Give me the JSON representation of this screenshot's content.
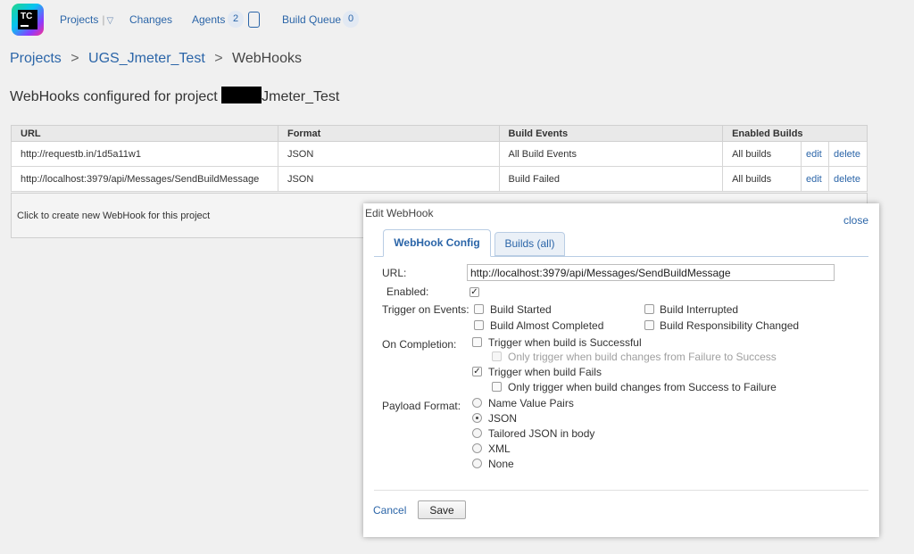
{
  "nav": {
    "logo_text": "TC",
    "projects": "Projects",
    "projects_sep": "|",
    "caret": "▽",
    "changes": "Changes",
    "agents": "Agents",
    "agents_count": "2",
    "build_queue": "Build Queue",
    "queue_count": "0"
  },
  "breadcrumb": {
    "root": "Projects",
    "sep": ">",
    "project": "UGS_Jmeter_Test",
    "current": "WebHooks"
  },
  "page_title": {
    "prefix": "WebHooks configured for project",
    "suffix": "Jmeter_Test"
  },
  "table": {
    "headers": [
      "URL",
      "Format",
      "Build Events",
      "Enabled Builds"
    ],
    "rows": [
      {
        "url": "http://requestb.in/1d5a11w1",
        "format": "JSON",
        "events": "All Build Events",
        "builds": "All builds",
        "edit": "edit",
        "delete": "delete"
      },
      {
        "url": "http://localhost:3979/api/Messages/SendBuildMessage",
        "format": "JSON",
        "events": "Build Failed",
        "builds": "All builds",
        "edit": "edit",
        "delete": "delete"
      }
    ],
    "create_text": "Click to create new WebHook for this project"
  },
  "dialog": {
    "title": "Edit WebHook",
    "close": "close",
    "tabs": [
      "WebHook Config",
      "Builds (all)"
    ],
    "url_label": "URL:",
    "url_value": "http://localhost:3979/api/Messages/SendBuildMessage",
    "enabled_label": "Enabled:",
    "check_mark": "✓",
    "trigger_label": "Trigger on Events:",
    "events": {
      "build_started": "Build Started",
      "build_interrupted": "Build Interrupted",
      "build_almost_completed": "Build Almost Completed",
      "build_responsibility_changed": "Build Responsibility Changed"
    },
    "completion_label": "On Completion:",
    "completion": {
      "successful": "Trigger when build is Successful",
      "only_failure_to_success": "Only trigger when build changes from Failure to Success",
      "fails": "Trigger when build Fails",
      "only_success_to_failure": "Only trigger when build changes from Success to Failure"
    },
    "payload_label": "Payload Format:",
    "payload_options": [
      "Name Value Pairs",
      "JSON",
      "Tailored JSON in body",
      "XML",
      "None"
    ],
    "payload_selected": "JSON",
    "cancel": "Cancel",
    "save": "Save"
  }
}
